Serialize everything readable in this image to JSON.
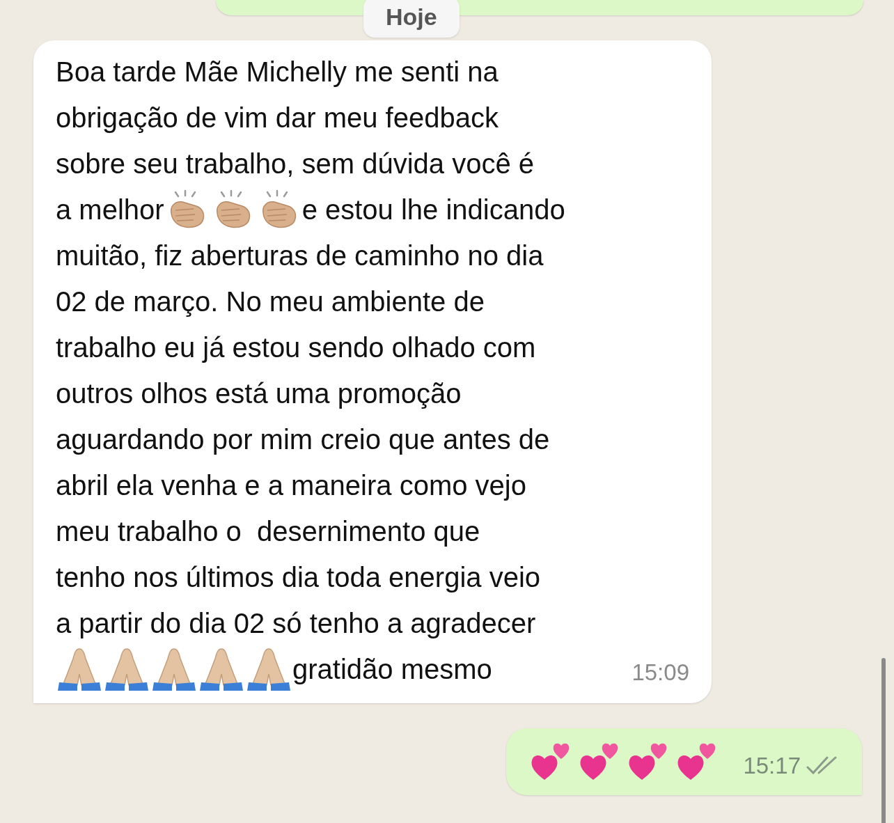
{
  "date_chip": "Hoje",
  "incoming": {
    "time": "15:09",
    "lines": [
      {
        "parts": [
          {
            "kind": "text",
            "text": "Boa tarde Mãe Michelly me senti na"
          }
        ]
      },
      {
        "parts": [
          {
            "kind": "text",
            "text": "obrigação de vim dar meu feedback"
          }
        ]
      },
      {
        "parts": [
          {
            "kind": "text",
            "text": "sobre seu trabalho, sem dúvida você é"
          }
        ]
      },
      {
        "parts": [
          {
            "kind": "text",
            "text": "a melhor"
          },
          {
            "kind": "clap"
          },
          {
            "kind": "clap"
          },
          {
            "kind": "clap"
          },
          {
            "kind": "text",
            "text": "e estou lhe indicando"
          }
        ]
      },
      {
        "parts": [
          {
            "kind": "text",
            "text": "muitão, fiz aberturas de caminho no dia"
          }
        ]
      },
      {
        "parts": [
          {
            "kind": "text",
            "text": "02 de março. No meu ambiente de"
          }
        ]
      },
      {
        "parts": [
          {
            "kind": "text",
            "text": "trabalho eu já estou sendo olhado com"
          }
        ]
      },
      {
        "parts": [
          {
            "kind": "text",
            "text": "outros olhos está uma promoção"
          }
        ]
      },
      {
        "parts": [
          {
            "kind": "text",
            "text": "aguardando por mim creio que antes de"
          }
        ]
      },
      {
        "parts": [
          {
            "kind": "text",
            "text": "abril ela venha e a maneira como vejo"
          }
        ]
      },
      {
        "parts": [
          {
            "kind": "text",
            "text": "meu trabalho o  desernimento que"
          }
        ]
      },
      {
        "parts": [
          {
            "kind": "text",
            "text": "tenho nos últimos dia toda energia veio"
          }
        ]
      },
      {
        "parts": [
          {
            "kind": "text",
            "text": "a partir do dia 02 só tenho a agradecer"
          }
        ]
      },
      {
        "parts": [
          {
            "kind": "pray"
          },
          {
            "kind": "pray"
          },
          {
            "kind": "pray"
          },
          {
            "kind": "pray"
          },
          {
            "kind": "pray"
          },
          {
            "kind": "text",
            "text": "gratidão mesmo"
          }
        ]
      }
    ]
  },
  "outgoing": {
    "time": "15:17",
    "read": false,
    "parts": [
      {
        "kind": "hearts"
      },
      {
        "kind": "hearts"
      },
      {
        "kind": "hearts"
      },
      {
        "kind": "hearts"
      }
    ]
  }
}
